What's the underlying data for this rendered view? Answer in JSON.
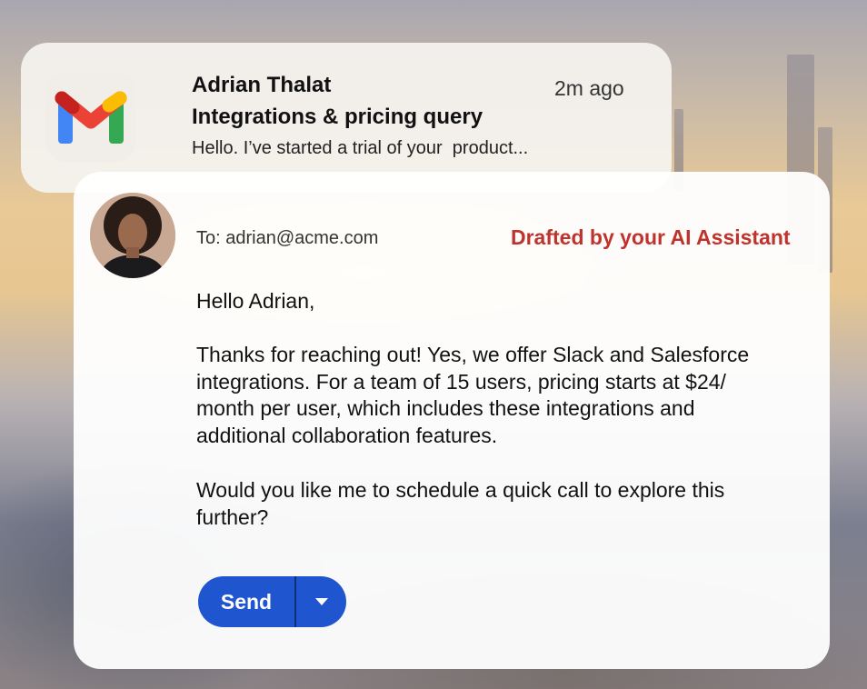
{
  "notification": {
    "sender": "Adrian Thalat",
    "time": "2m ago",
    "subject": "Integrations & pricing query",
    "preview": "Hello. I’ve started a trial of your  product...",
    "app_icon": "gmail-icon"
  },
  "draft": {
    "to": "To: adrian@acme.com",
    "ai_label": "Drafted by your AI Assistant",
    "greeting": "Hello Adrian,",
    "paragraph1_lines": [
      "Thanks for reaching out! Yes, we offer Slack and Salesforce",
      "integrations. For a team of 15 users, pricing starts at $24/",
      "month per user, which includes these integrations and",
      "additional collaboration features."
    ],
    "paragraph2_lines": [
      "Would you like me to schedule a quick call to explore this",
      "further?"
    ],
    "send_label": "Send",
    "dropdown_icon": "caret-down-icon",
    "avatar_icon": "avatar-photo"
  },
  "colors": {
    "ai_label": "#c0332d",
    "send_button": "#1f55cf",
    "gmail_red": "#ea4335",
    "gmail_blue": "#4285f4",
    "gmail_green": "#34a853",
    "gmail_yellow": "#fbbc04"
  }
}
